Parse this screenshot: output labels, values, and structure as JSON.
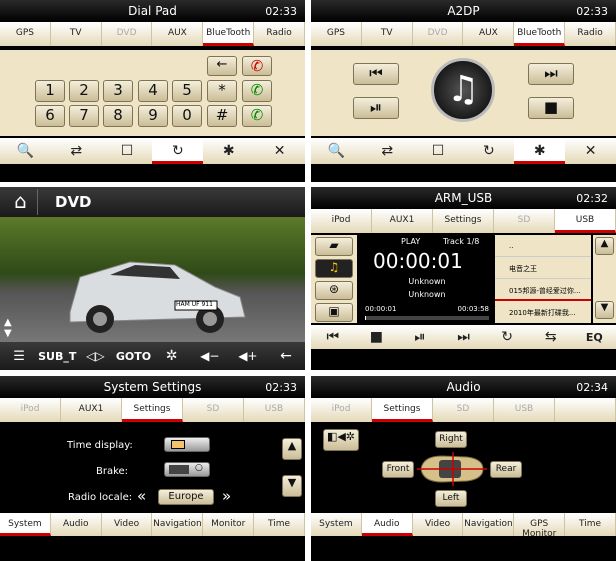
{
  "dial": {
    "title": "Dial Pad",
    "clock": "02:33",
    "tabs": [
      "GPS",
      "TV",
      "DVD",
      "AUX",
      "BlueTooth",
      "Radio"
    ],
    "keys": [
      "1",
      "2",
      "3",
      "4",
      "5",
      "*",
      "6",
      "7",
      "8",
      "9",
      "0",
      "#"
    ],
    "back": "←",
    "hang": "✆",
    "call": "✆",
    "call2": "✆"
  },
  "a2dp": {
    "title": "A2DP",
    "clock": "02:33",
    "tabs": [
      "GPS",
      "TV",
      "DVD",
      "AUX",
      "BlueTooth",
      "Radio"
    ],
    "prev": "⏮",
    "next": "⏭",
    "play": "⏯",
    "stop": "■",
    "music": "♫"
  },
  "bottom_icons": [
    "🔍",
    "⇄",
    "☐",
    "↻",
    "✱",
    "✕"
  ],
  "dvd": {
    "title": "DVD",
    "home": "⌂",
    "plate": "HAM UF 911",
    "controls": [
      "☰",
      "SUB_T",
      "◁▷",
      "GOTO",
      "✲",
      "◀−",
      "◀+",
      "←"
    ]
  },
  "usb": {
    "title": "ARM_USB",
    "clock": "02:32",
    "tabs": [
      "iPod",
      "AUX1",
      "Settings",
      "SD",
      "USB"
    ],
    "status": "PLAY",
    "track": "Track 1/8",
    "time": "00:00:01",
    "artist": "Unknown",
    "album": "Unknown",
    "elapsed": "00:00:01",
    "total": "00:03:58",
    "progress": 0.004,
    "files": [
      "..",
      "电音之王",
      "015邦源-曾经爱过你...",
      "2010年最新打碟我..."
    ],
    "controls": [
      "⏮",
      "■",
      "⏯",
      "⏭",
      "↻",
      "⇆",
      "EQ"
    ]
  },
  "sys": {
    "title": "System Settings",
    "clock": "02:33",
    "tabs": [
      "iPod",
      "AUX1",
      "Settings",
      "SD",
      "USB"
    ],
    "time_label": "Time display:",
    "brake_label": "Brake:",
    "locale_label": "Radio locale:",
    "locale": "Europe",
    "bottom_tabs": [
      "System",
      "Audio",
      "Video",
      "Navigation",
      "Monitor",
      "Time"
    ]
  },
  "audio": {
    "title": "Audio",
    "clock": "02:34",
    "tabs": [
      "iPod",
      "Settings",
      "SD",
      "USB"
    ],
    "right": "Right",
    "left": "Left",
    "front": "Front",
    "rear": "Rear",
    "bottom_tabs": [
      "System",
      "Audio",
      "Video",
      "Navigation",
      "GPS Monitor",
      "Time"
    ]
  }
}
